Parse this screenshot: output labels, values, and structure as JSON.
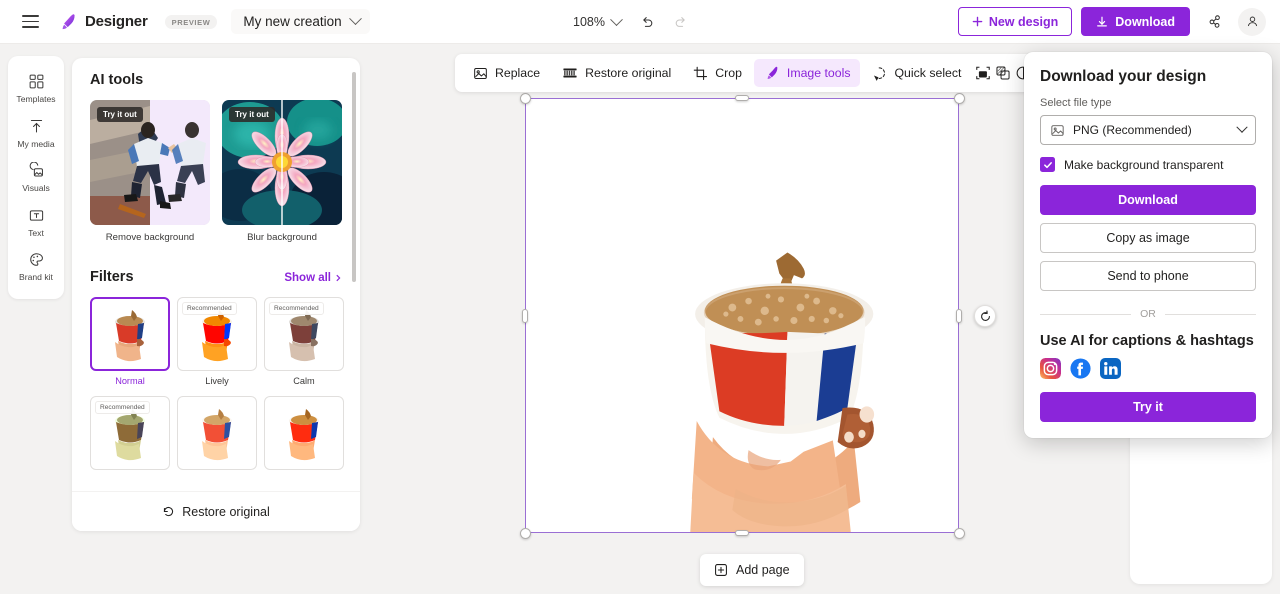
{
  "header": {
    "menu_icon": "hamburger-icon",
    "brand": "Designer",
    "preview_badge": "PREVIEW",
    "doc_title": "My new creation",
    "zoom_level": "108%",
    "undo_icon": "undo-icon",
    "redo_icon": "redo-icon",
    "new_design_label": "New design",
    "download_label": "Download",
    "share_icon": "share-icon",
    "account_icon": "account-icon"
  },
  "rail": {
    "items": [
      {
        "label": "Templates",
        "icon": "templates-icon"
      },
      {
        "label": "My media",
        "icon": "upload-icon"
      },
      {
        "label": "Visuals",
        "icon": "visuals-icon"
      },
      {
        "label": "Text",
        "icon": "text-icon"
      },
      {
        "label": "Brand kit",
        "icon": "palette-icon"
      }
    ]
  },
  "panel": {
    "ai_tools_title": "AI tools",
    "try_badge": "Try it out",
    "ai_tools": [
      {
        "caption": "Remove background"
      },
      {
        "caption": "Blur background"
      }
    ],
    "filters_title": "Filters",
    "show_all_label": "Show all",
    "recommended_badge": "Recommended",
    "filters": [
      {
        "name": "Normal",
        "selected": true,
        "recommended": false
      },
      {
        "name": "Lively",
        "selected": false,
        "recommended": true
      },
      {
        "name": "Calm",
        "selected": false,
        "recommended": true
      },
      {
        "name": "",
        "selected": false,
        "recommended": true
      },
      {
        "name": "",
        "selected": false,
        "recommended": false
      },
      {
        "name": "",
        "selected": false,
        "recommended": false
      }
    ],
    "restore_original_label": "Restore original"
  },
  "toolbar": {
    "items": [
      {
        "label": "Replace",
        "icon": "image-replace-icon",
        "active": false
      },
      {
        "label": "Restore original",
        "icon": "restore-icon",
        "active": false
      },
      {
        "label": "Crop",
        "icon": "crop-icon",
        "active": false
      },
      {
        "label": "Image tools",
        "icon": "image-tools-icon",
        "active": true
      },
      {
        "label": "Quick select",
        "icon": "quick-select-icon",
        "active": false
      }
    ],
    "icon_buttons": [
      {
        "icon": "fit-image-icon"
      },
      {
        "icon": "transparency-icon"
      },
      {
        "icon": "contrast-icon"
      }
    ]
  },
  "canvas": {
    "add_page_label": "Add page",
    "rotate_icon": "rotate-icon"
  },
  "flyout": {
    "title": "Download your design",
    "file_type_label": "Select file type",
    "file_type_value": "PNG (Recommended)",
    "file_type_icon": "image-file-icon",
    "transparent_label": "Make background transparent",
    "transparent_checked": true,
    "download_label": "Download",
    "copy_label": "Copy as image",
    "send_phone_label": "Send to phone",
    "or_label": "OR",
    "ai_title": "Use AI for captions & hashtags",
    "socials": [
      {
        "name": "instagram-icon"
      },
      {
        "name": "facebook-icon"
      },
      {
        "name": "linkedin-icon"
      }
    ],
    "try_it_label": "Try it"
  },
  "colors": {
    "accent": "#8b25da",
    "accent_soft": "#f5e8fd",
    "selection": "#9a6fd4",
    "canvas_bg": "#f3f2f1"
  }
}
